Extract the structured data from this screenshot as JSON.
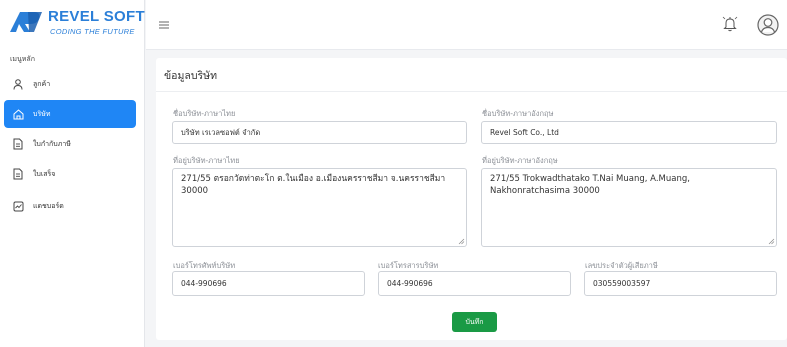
{
  "brand": {
    "name": "REVEL SOFT",
    "tagline": "CODING THE FUTURE",
    "color": "#2b7fd8"
  },
  "sidebar": {
    "heading": "เมนูหลัก",
    "items": [
      {
        "label": "ลูกค้า",
        "icon": "user-icon",
        "active": false
      },
      {
        "label": "บริษัท",
        "icon": "home-icon",
        "active": true
      },
      {
        "label": "ใบกำกับภาษี",
        "icon": "document-icon",
        "active": false
      },
      {
        "label": "ใบเสร็จ",
        "icon": "receipt-icon",
        "active": false
      },
      {
        "label": "แดชบอร์ด",
        "icon": "chart-icon",
        "active": false
      }
    ]
  },
  "topbar": {
    "menu_icon": "hamburger-icon",
    "notification_icon": "bell-icon",
    "profile_icon": "avatar-icon"
  },
  "company": {
    "title": "ข้อมูลบริษัท",
    "name_th_label": "ชื่อบริษัท-ภาษาไทย",
    "name_th": "บริษัท เรเวลซอฟต์ จำกัด",
    "name_en_label": "ชื่อบริษัท-ภาษาอังกฤษ",
    "name_en": "Revel Soft Co., Ltd",
    "address_th_label": "ที่อยู่บริษัท-ภาษาไทย",
    "address_th": "271/55 ตรอกวัดท่าตะโก ต.ในเมือง อ.เมืองนครราชสีมา จ.นครราชสีมา 30000",
    "address_en_label": "ที่อยู่บริษัท-ภาษาอังกฤษ",
    "address_en": "271/55 Trokwadthatako T.Nai Muang, A.Muang, Nakhonratchasima 30000",
    "phone_label": "เบอร์โทรศัพท์บริษัท",
    "phone": "044-990696",
    "fax_label": "เบอร์โทรสารบริษัท",
    "fax": "044-990696",
    "taxid_label": "เลขประจำตัวผู้เสียภาษี",
    "taxid": "030559003597",
    "save_label": "บันทึก"
  },
  "colors": {
    "accent": "#1f86f5",
    "save": "#1a9a45",
    "background": "#f4f5f7"
  }
}
